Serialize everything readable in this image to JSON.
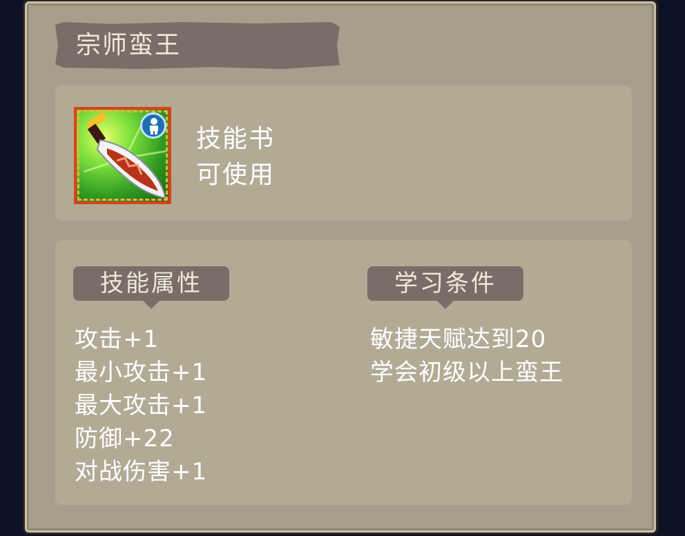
{
  "title": "宗师蛮王",
  "item": {
    "icon": "scimitar-skill-icon",
    "badge_icon": "person-icon",
    "type_label": "技能书",
    "status_label": "可使用"
  },
  "attributes": {
    "header": "技能属性",
    "items": [
      "攻击+1",
      "最小攻击+1",
      "最大攻击+1",
      "防御+22",
      "对战伤害+1"
    ]
  },
  "requirements": {
    "header": "学习条件",
    "items": [
      "敏捷天赋达到20",
      "学会初级以上蛮王"
    ]
  },
  "colors": {
    "panel": "#a79e8b",
    "box": "#b3aa96",
    "banner": "#7a6d68",
    "text": "#ffffff"
  }
}
